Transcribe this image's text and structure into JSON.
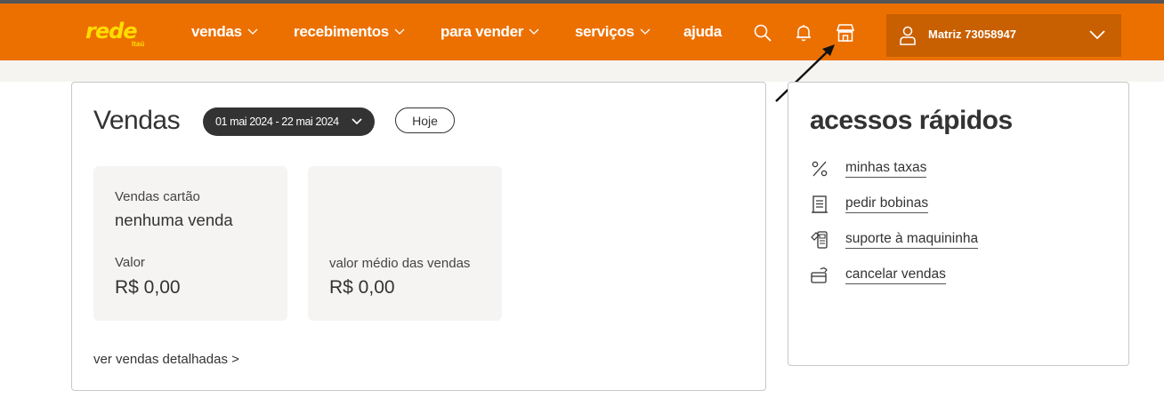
{
  "header": {
    "logo": {
      "main": "rede",
      "sub": "Itaú"
    },
    "nav": [
      {
        "label": "vendas",
        "has_dropdown": true
      },
      {
        "label": "recebimentos",
        "has_dropdown": true
      },
      {
        "label": "para vender",
        "has_dropdown": true
      },
      {
        "label": "serviços",
        "has_dropdown": true
      },
      {
        "label": "ajuda",
        "has_dropdown": false
      }
    ],
    "icons": [
      "search-icon",
      "bell-icon",
      "store-icon"
    ],
    "user": {
      "label": "Matriz 73058947"
    }
  },
  "vendas": {
    "title": "Vendas",
    "date_range": "01 mai 2024 - 22 mai 2024",
    "today_button": "Hoje",
    "card_sales": {
      "label": "Vendas cartão",
      "value": "nenhuma venda",
      "amount_label": "Valor",
      "amount": "R$ 0,00"
    },
    "avg_sales": {
      "label": "valor médio das vendas",
      "amount": "R$ 0,00"
    },
    "details_link": "ver vendas detalhadas >"
  },
  "acessos": {
    "title": "acessos rápidos",
    "items": [
      {
        "label": "minhas taxas",
        "icon": "percent-icon"
      },
      {
        "label": "pedir bobinas",
        "icon": "receipt-icon"
      },
      {
        "label": "suporte à maquininha",
        "icon": "card-machine-icon"
      },
      {
        "label": "cancelar vendas",
        "icon": "card-cancel-icon"
      }
    ]
  },
  "colors": {
    "brand_orange": "#ec7000",
    "user_box": "#c85f00",
    "logo_yellow": "#ffdd00",
    "dark_pill": "#333333"
  }
}
